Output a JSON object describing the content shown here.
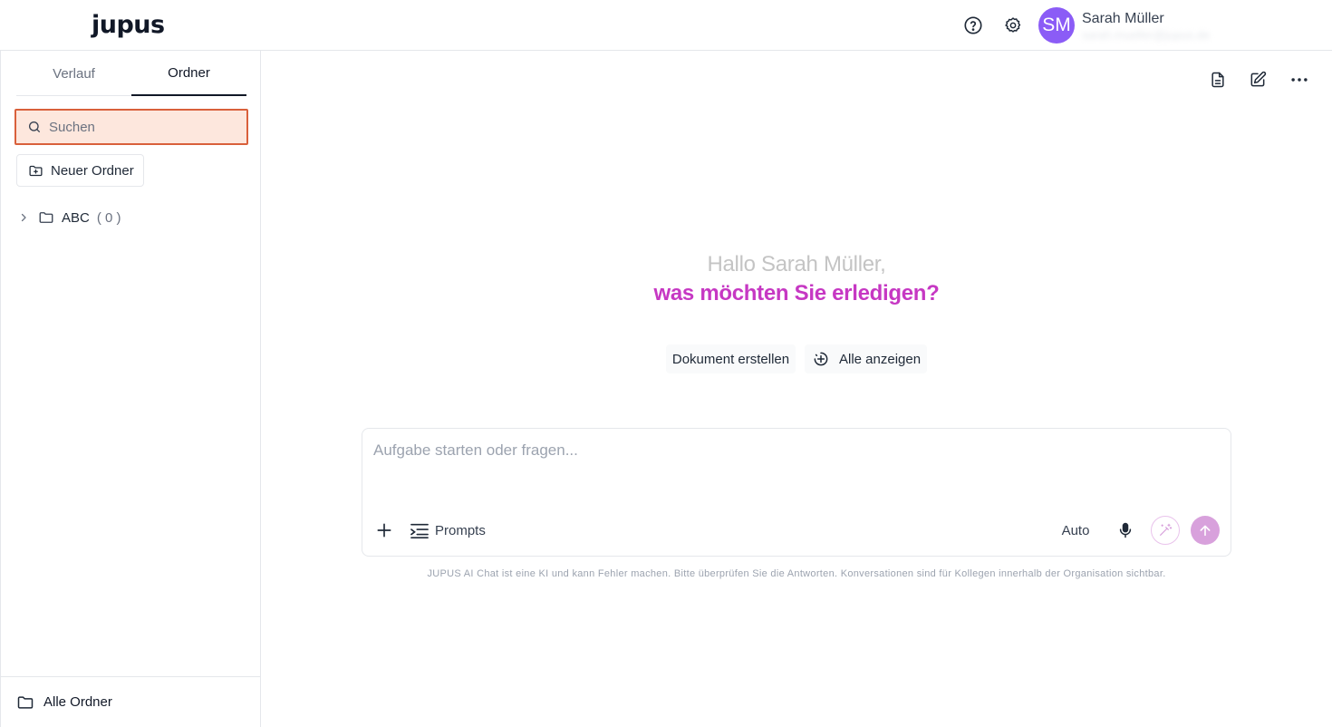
{
  "header": {
    "logo": "jupus",
    "user": {
      "initials": "SM",
      "name": "Sarah Müller",
      "email": "sarah.mueller@jupus.de",
      "avatar_color": "#8b5cf6"
    },
    "icons": [
      "help-circle-icon",
      "gear-icon"
    ]
  },
  "sidebar": {
    "tabs": [
      {
        "label": "Verlauf",
        "active": false
      },
      {
        "label": "Ordner",
        "active": true
      }
    ],
    "search": {
      "placeholder": "Suchen",
      "value": ""
    },
    "new_folder_label": "Neuer Ordner",
    "folders": [
      {
        "name": "ABC",
        "count": "( 0 )"
      }
    ],
    "footer_label": "Alle Ordner"
  },
  "main": {
    "greeting_line1": "Hallo Sarah Müller,",
    "greeting_line2": "was möchten Sie erledigen?",
    "chips": {
      "create_document": "Dokument erstellen",
      "show_all": "Alle anzeigen"
    },
    "composer": {
      "placeholder": "Aufgabe starten oder fragen...",
      "value": "",
      "prompts_label": "Prompts",
      "model_label": "Auto"
    },
    "disclaimer": "JUPUS AI Chat ist eine KI und kann Fehler machen. Bitte überprüfen Sie die Antworten. Konversationen sind für Kollegen innerhalb der Organisation sichtbar."
  },
  "colors": {
    "accent": "#c638c3",
    "search_border": "#d9603b",
    "search_bg": "#fde7dd",
    "send_disabled": "#d8a1dc"
  }
}
